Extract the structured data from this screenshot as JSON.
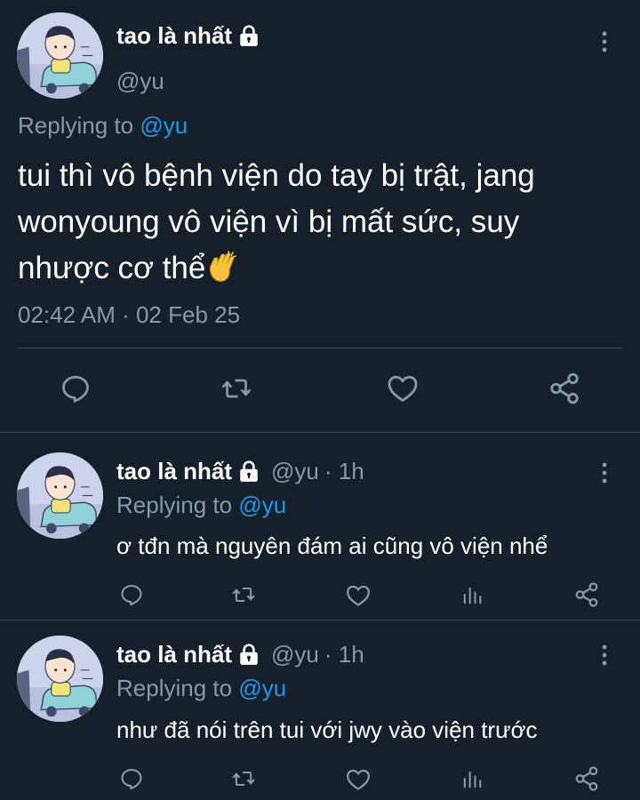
{
  "main_tweet": {
    "display_name": "tao là nhất",
    "handle": "@yu",
    "replying_label": "Replying to",
    "replying_mention": "@yu",
    "text_lines": [
      "tui thì vô bệnh viện do tay bị trật, jang",
      "wonyoung vô viện vì bị mất sức, suy",
      "nhược cơ thể"
    ],
    "emoji": "clapping-hands",
    "timestamp": "02:42 AM · 02 Feb 25",
    "actions": [
      "reply",
      "retweet",
      "like",
      "share"
    ]
  },
  "replies": [
    {
      "display_name": "tao là nhất",
      "handle": "@yu",
      "time": "· 1h",
      "replying_label": "Replying to",
      "replying_mention": "@yu",
      "text": "ơ tđn mà nguyên đám ai cũng vô viện nhể",
      "actions": [
        "reply",
        "retweet",
        "like",
        "views",
        "share"
      ]
    },
    {
      "display_name": "tao là nhất",
      "handle": "@yu",
      "time": "· 1h",
      "replying_label": "Replying to",
      "replying_mention": "@yu",
      "text": "như đã nói trên tui với jwy vào viện trước",
      "actions": [
        "reply",
        "retweet",
        "like",
        "views",
        "share"
      ]
    }
  ],
  "colors": {
    "background": "#15202b",
    "text_primary": "#ffffff",
    "text_secondary": "#8b98a5",
    "mention": "#1d9bf0",
    "divider": "#38444d"
  }
}
